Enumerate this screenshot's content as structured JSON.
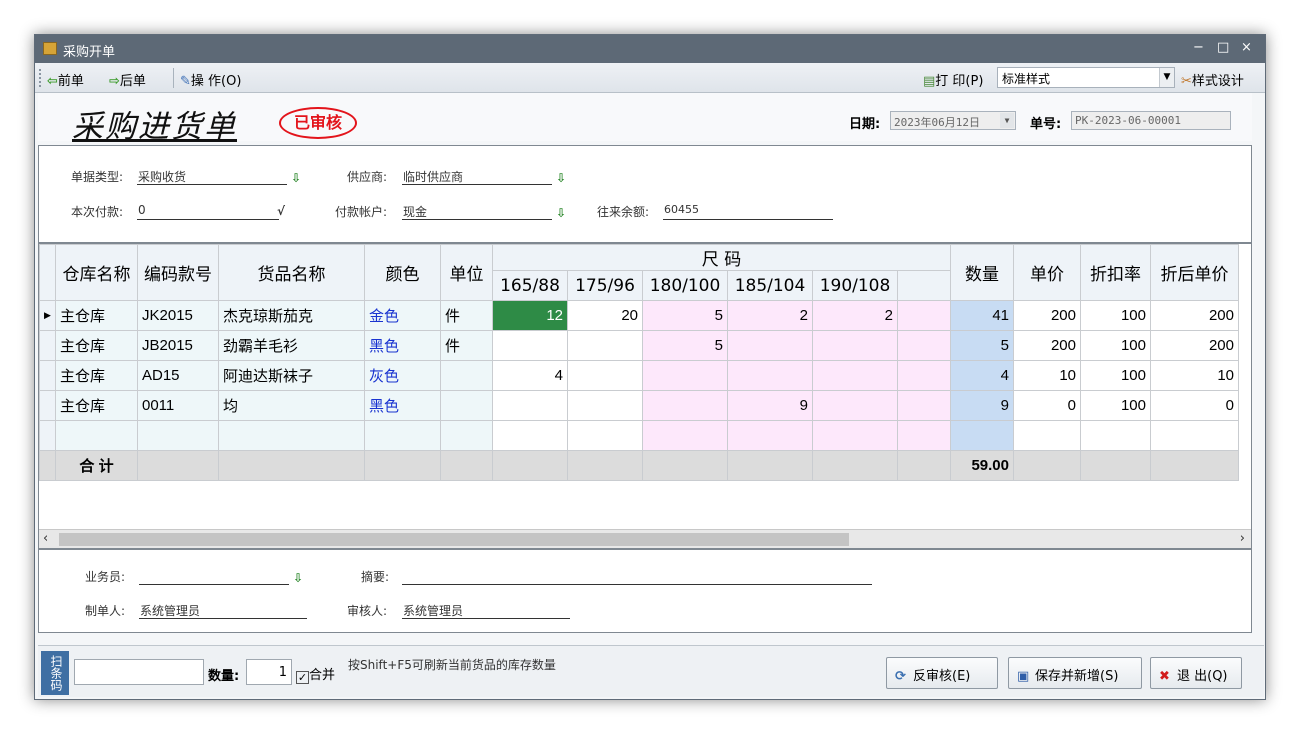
{
  "window": {
    "title": "采购开单"
  },
  "window_controls": {
    "minimize": "−",
    "maximize": "□",
    "close": "×"
  },
  "toolbar": {
    "prev": "前单",
    "next": "后单",
    "operate": "操 作(O)",
    "print": "打 印(P)",
    "print_style": "标准样式",
    "style_design": "样式设计"
  },
  "header": {
    "title": "采购进货单",
    "stamp": "已审核",
    "date_label": "日期:",
    "date_value": "2023年06月12日",
    "number_label": "单号:",
    "number_value": "PK-2023-06-00001"
  },
  "info": {
    "doc_type_label": "单据类型:",
    "doc_type_value": "采购收货",
    "supplier_label": "供应商:",
    "supplier_value": "临时供应商",
    "payment_label": "本次付款:",
    "payment_value": "0",
    "account_label": "付款帐户:",
    "account_value": "现金",
    "balance_label": "往来余额:",
    "balance_value": "60455"
  },
  "grid": {
    "headers": {
      "warehouse": "仓库名称",
      "code": "编码款号",
      "name": "货品名称",
      "color": "颜色",
      "unit": "单位",
      "size_group": "尺 码",
      "qty": "数量",
      "price": "单价",
      "discount": "折扣率",
      "net_price": "折后单价"
    },
    "sizes": [
      "165/88",
      "175/96",
      "180/100",
      "185/104",
      "190/108",
      ""
    ],
    "rows": [
      {
        "warehouse": "主仓库",
        "code": "JK2015",
        "name": "杰克琼斯茄克",
        "color": "金色",
        "unit": "件",
        "sizes": [
          "12",
          "20",
          "5",
          "2",
          "2",
          ""
        ],
        "qty": "41",
        "price": "200",
        "discount": "100",
        "net_price": "200"
      },
      {
        "warehouse": "主仓库",
        "code": "JB2015",
        "name": "劲霸羊毛衫",
        "color": "黑色",
        "unit": "件",
        "sizes": [
          "",
          "",
          "5",
          "",
          "",
          ""
        ],
        "qty": "5",
        "price": "200",
        "discount": "100",
        "net_price": "200"
      },
      {
        "warehouse": "主仓库",
        "code": "AD15",
        "name": "阿迪达斯袜子",
        "color": "灰色",
        "unit": "",
        "sizes": [
          "4",
          "",
          "",
          "",
          "",
          ""
        ],
        "qty": "4",
        "price": "10",
        "discount": "100",
        "net_price": "10"
      },
      {
        "warehouse": "主仓库",
        "code": "0011",
        "name": "均",
        "color": "黑色",
        "unit": "",
        "sizes": [
          "",
          "",
          "",
          "9",
          "",
          ""
        ],
        "qty": "9",
        "price": "0",
        "discount": "100",
        "net_price": "0"
      }
    ],
    "total_label": "合 计",
    "total_qty": "59.00"
  },
  "footer": {
    "salesman_label": "业务员:",
    "salesman_value": "",
    "memo_label": "摘要:",
    "memo_value": "",
    "maker_label": "制单人:",
    "maker_value": "系统管理员",
    "auditor_label": "审核人:",
    "auditor_value": "系统管理员"
  },
  "status": {
    "scan_label": "扫条码",
    "qty_label": "数量:",
    "qty_value": "1",
    "merge_label": "合并",
    "hint": "按Shift+F5可刷新当前货品的库存数量",
    "unaudit_button": "反审核(E)",
    "save_new_button": "保存并新增(S)",
    "exit_button": "退 出(Q)"
  }
}
